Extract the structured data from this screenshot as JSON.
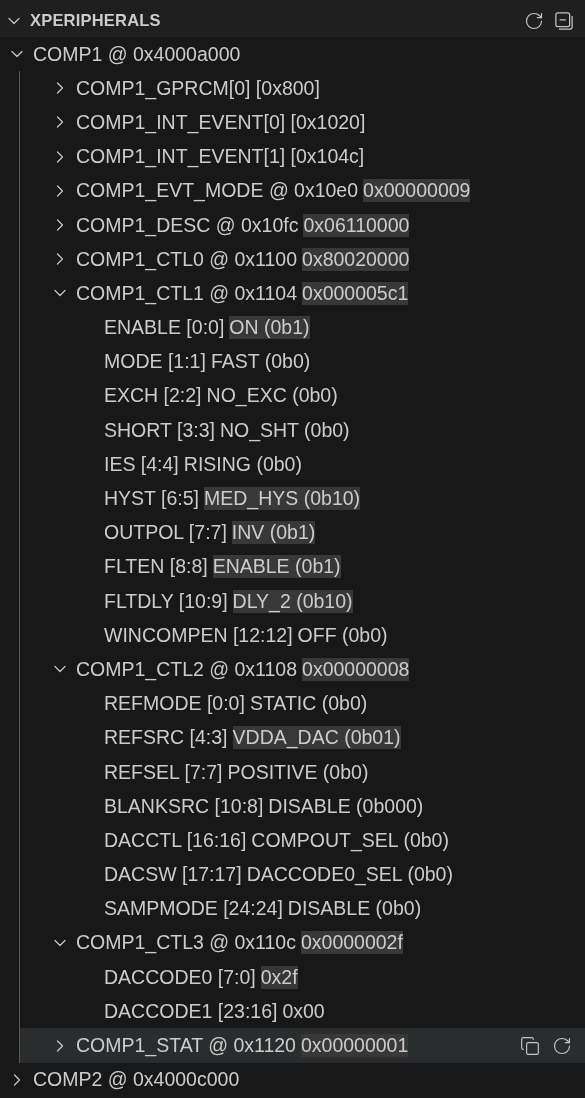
{
  "panel": {
    "title": "XPERIPHERALS",
    "expanded": true
  },
  "tree": [
    {
      "kind": "node",
      "label": "COMP1 @ 0x4000a000",
      "expanded": true,
      "hovered": false,
      "children": [
        {
          "kind": "node",
          "label": "COMP1_GPRCM[0] [0x800]",
          "expanded": false,
          "hovered": false
        },
        {
          "kind": "node",
          "label": "COMP1_INT_EVENT[0] [0x1020]",
          "expanded": false,
          "hovered": false
        },
        {
          "kind": "node",
          "label": "COMP1_INT_EVENT[1] [0x104c]",
          "expanded": false,
          "hovered": false
        },
        {
          "kind": "node",
          "label": "COMP1_EVT_MODE @ 0x10e0",
          "value": "0x00000009",
          "highlighted": true,
          "expanded": false,
          "hovered": false
        },
        {
          "kind": "node",
          "label": "COMP1_DESC @ 0x10fc",
          "value": "0x06110000",
          "highlighted": true,
          "expanded": false,
          "hovered": false
        },
        {
          "kind": "node",
          "label": "COMP1_CTL0 @ 0x1100",
          "value": "0x80020000",
          "highlighted": true,
          "expanded": false,
          "hovered": false
        },
        {
          "kind": "node",
          "label": "COMP1_CTL1 @ 0x1104",
          "value": "0x000005c1",
          "highlighted": true,
          "expanded": true,
          "hovered": false,
          "children": [
            {
              "kind": "field",
              "label": "ENABLE [0:0]",
              "value": "ON (0b1)",
              "highlighted": true
            },
            {
              "kind": "field",
              "label": "MODE [1:1]",
              "value": "FAST (0b0)",
              "highlighted": false
            },
            {
              "kind": "field",
              "label": "EXCH [2:2]",
              "value": "NO_EXC (0b0)",
              "highlighted": false
            },
            {
              "kind": "field",
              "label": "SHORT [3:3]",
              "value": "NO_SHT (0b0)",
              "highlighted": false
            },
            {
              "kind": "field",
              "label": "IES [4:4]",
              "value": "RISING (0b0)",
              "highlighted": false
            },
            {
              "kind": "field",
              "label": "HYST [6:5]",
              "value": "MED_HYS (0b10)",
              "highlighted": true
            },
            {
              "kind": "field",
              "label": "OUTPOL [7:7]",
              "value": "INV (0b1)",
              "highlighted": true
            },
            {
              "kind": "field",
              "label": "FLTEN [8:8]",
              "value": "ENABLE (0b1)",
              "highlighted": true
            },
            {
              "kind": "field",
              "label": "FLTDLY [10:9]",
              "value": "DLY_2 (0b10)",
              "highlighted": true
            },
            {
              "kind": "field",
              "label": "WINCOMPEN [12:12]",
              "value": "OFF (0b0)",
              "highlighted": false
            }
          ]
        },
        {
          "kind": "node",
          "label": "COMP1_CTL2 @ 0x1108",
          "value": "0x00000008",
          "highlighted": true,
          "expanded": true,
          "hovered": false,
          "children": [
            {
              "kind": "field",
              "label": "REFMODE [0:0]",
              "value": "STATIC (0b0)",
              "highlighted": false
            },
            {
              "kind": "field",
              "label": "REFSRC [4:3]",
              "value": "VDDA_DAC (0b01)",
              "highlighted": true
            },
            {
              "kind": "field",
              "label": "REFSEL [7:7]",
              "value": "POSITIVE (0b0)",
              "highlighted": false
            },
            {
              "kind": "field",
              "label": "BLANKSRC [10:8]",
              "value": "DISABLE (0b000)",
              "highlighted": false
            },
            {
              "kind": "field",
              "label": "DACCTL [16:16]",
              "value": "COMPOUT_SEL (0b0)",
              "highlighted": false
            },
            {
              "kind": "field",
              "label": "DACSW [17:17]",
              "value": "DACCODE0_SEL (0b0)",
              "highlighted": false
            },
            {
              "kind": "field",
              "label": "SAMPMODE [24:24]",
              "value": "DISABLE (0b0)",
              "highlighted": false
            }
          ]
        },
        {
          "kind": "node",
          "label": "COMP1_CTL3 @ 0x110c",
          "value": "0x0000002f",
          "highlighted": true,
          "expanded": true,
          "hovered": false,
          "children": [
            {
              "kind": "field",
              "label": "DACCODE0 [7:0]",
              "value": "0x2f",
              "highlighted": true
            },
            {
              "kind": "field",
              "label": "DACCODE1 [23:16]",
              "value": "0x00",
              "highlighted": false
            }
          ]
        },
        {
          "kind": "node",
          "label": "COMP1_STAT @ 0x1120",
          "value": "0x00000001",
          "highlighted": true,
          "expanded": false,
          "hovered": true
        }
      ]
    },
    {
      "kind": "node",
      "label": "COMP2 @ 0x4000c000",
      "expanded": false,
      "hovered": false
    }
  ]
}
